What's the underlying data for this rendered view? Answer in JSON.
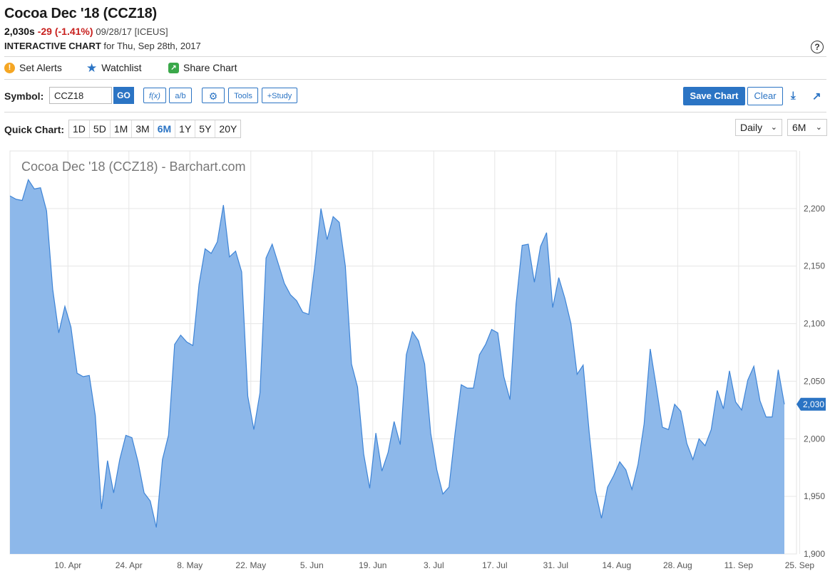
{
  "header": {
    "title": "Cocoa Dec '18 (CCZ18)",
    "price": "2,030s",
    "change": "-29 (-1.41%)",
    "meta": "09/28/17 [ICEUS]",
    "subtitle_bold": "INTERACTIVE CHART",
    "subtitle_rest": " for Thu, Sep 28th, 2017",
    "help_glyph": "?"
  },
  "actions": {
    "set_alerts": "Set Alerts",
    "watchlist": "Watchlist",
    "share_chart": "Share Chart"
  },
  "toolbar": {
    "symbol_label": "Symbol:",
    "symbol_value": "CCZ18",
    "go_label": "GO",
    "fx_label": "f(x)",
    "ab_label": "a/b",
    "tools_label": "Tools",
    "study_label": "+Study",
    "save_label": "Save Chart",
    "clear_label": "Clear"
  },
  "quick_chart": {
    "label": "Quick Chart:",
    "ranges": [
      "1D",
      "5D",
      "1M",
      "3M",
      "6M",
      "1Y",
      "5Y",
      "20Y"
    ],
    "active": "6M",
    "interval": "Daily",
    "period": "6M"
  },
  "colors": {
    "accent": "#2b74c4",
    "negative": "#c8201e",
    "area_fill": "#8db8ea",
    "area_line": "#3e84d6"
  },
  "chart_data": {
    "type": "area",
    "title": "Cocoa Dec '18 (CCZ18) - Barchart.com",
    "ylim": [
      1900,
      2250
    ],
    "y_ticks": [
      1900,
      1950,
      2000,
      2050,
      2100,
      2150,
      2200
    ],
    "y_tick_labels": [
      "1,900",
      "1,950",
      "2,000",
      "2,050",
      "2,100",
      "2,150",
      "2,200"
    ],
    "x_ticks": [
      {
        "label": "10. Apr",
        "index": 9
      },
      {
        "label": "24. Apr",
        "index": 19
      },
      {
        "label": "8. May",
        "index": 29
      },
      {
        "label": "22. May",
        "index": 39
      },
      {
        "label": "5. Jun",
        "index": 49
      },
      {
        "label": "19. Jun",
        "index": 59
      },
      {
        "label": "3. Jul",
        "index": 69
      },
      {
        "label": "17. Jul",
        "index": 79
      },
      {
        "label": "31. Jul",
        "index": 89
      },
      {
        "label": "14. Aug",
        "index": 99
      },
      {
        "label": "28. Aug",
        "index": 109
      },
      {
        "label": "11. Sep",
        "index": 119
      },
      {
        "label": "25. Sep",
        "index": 129
      }
    ],
    "last_value": 2030,
    "last_label": "2,030",
    "grid": true,
    "values": [
      2211,
      2208,
      2207,
      2225,
      2217,
      2218,
      2198,
      2130,
      2092,
      2115,
      2097,
      2057,
      2054,
      2055,
      2020,
      1939,
      1981,
      1953,
      1982,
      2003,
      2001,
      1980,
      1953,
      1946,
      1923,
      1982,
      2003,
      2082,
      2090,
      2084,
      2081,
      2134,
      2165,
      2161,
      2171,
      2203,
      2158,
      2163,
      2145,
      2037,
      2008,
      2040,
      2157,
      2169,
      2152,
      2135,
      2125,
      2120,
      2110,
      2108,
      2151,
      2200,
      2173,
      2193,
      2188,
      2150,
      2065,
      2045,
      1987,
      1957,
      2005,
      1972,
      1988,
      2015,
      1995,
      2073,
      2093,
      2085,
      2065,
      2005,
      1973,
      1952,
      1958,
      2005,
      2047,
      2044,
      2044,
      2073,
      2082,
      2095,
      2092,
      2054,
      2034,
      2117,
      2168,
      2169,
      2136,
      2167,
      2179,
      2114,
      2140,
      2122,
      2100,
      2056,
      2064,
      2005,
      1955,
      1931,
      1958,
      1968,
      1980,
      1973,
      1956,
      1978,
      2013,
      2078,
      2045,
      2010,
      2008,
      2030,
      2024,
      1996,
      1982,
      2000,
      1994,
      2008,
      2042,
      2026,
      2059,
      2032,
      2025,
      2051,
      2063,
      2033,
      2019,
      2019,
      2060,
      2030
    ]
  }
}
